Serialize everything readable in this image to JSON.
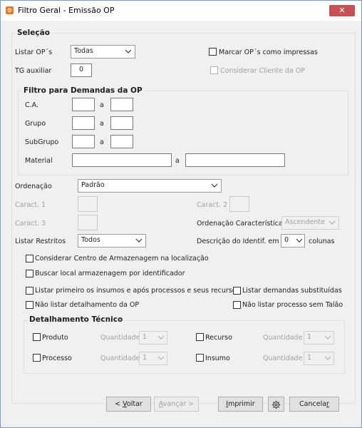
{
  "window": {
    "title": "Filtro Geral - Emissão OP",
    "close_glyph": "✕"
  },
  "selecao": {
    "title": "Seleção",
    "listar_ops_label": "Listar OP´s",
    "listar_ops_value": "Todas",
    "marcar_impressas": "Marcar OP´s como impressas",
    "tg_auxiliar_label": "TG auxiliar",
    "tg_auxiliar_value": "0",
    "considerar_cliente": "Considerar Cliente da OP",
    "filtro": {
      "title": "Filtro para Demandas da OP",
      "ca_label": "C.A.",
      "grupo_label": "Grupo",
      "subgrupo_label": "SubGrupo",
      "material_label": "Material",
      "a": "a"
    },
    "ordenacao_label": "Ordenação",
    "ordenacao_value": "Padrão",
    "caract1": "Caract. 1",
    "caract2": "Caract. 2",
    "caract3": "Caract. 3",
    "ordenacao_caract_label": "Ordenação Característica",
    "ordenacao_caract_value": "Ascendente",
    "listar_restritos_label": "Listar Restritos",
    "listar_restritos_value": "Todos",
    "descricao_label": "Descrição do Identif. em",
    "descricao_value": "0",
    "colunas": "colunas",
    "cb_centro": "Considerar Centro de Armazenagem na localização",
    "cb_buscar": "Buscar local armazenagem por identificador",
    "cb_listar_primeiro": "Listar primeiro os insumos e após processos e seus recursos",
    "cb_substituidas": "Listar demandas substituídas",
    "cb_nao_detalhamento": "Não listar detalhamento da OP",
    "cb_sem_talao": "Não listar processo sem Talão",
    "tecnico": {
      "title": "Detalhamento Técnico",
      "produto": "Produto",
      "processo": "Processo",
      "recurso": "Recurso",
      "insumo": "Insumo",
      "quantidade": "Quantidade",
      "qtd_value": "1"
    }
  },
  "buttons": {
    "voltar_pre": "< ",
    "voltar_u": "V",
    "voltar_post": "oltar",
    "avancar_u": "A",
    "avancar_post": "vançar >",
    "imprimir_u": "I",
    "imprimir_post": "mprimir",
    "cancelar_pre": "Cancela",
    "cancelar_u": "r"
  },
  "icons": [
    "app-icon",
    "close-icon",
    "chevron-down-icon",
    "gear-icon"
  ],
  "colors": {
    "close": "#c75050",
    "app_icon": "#e87722",
    "border": "#7a9cc6"
  }
}
